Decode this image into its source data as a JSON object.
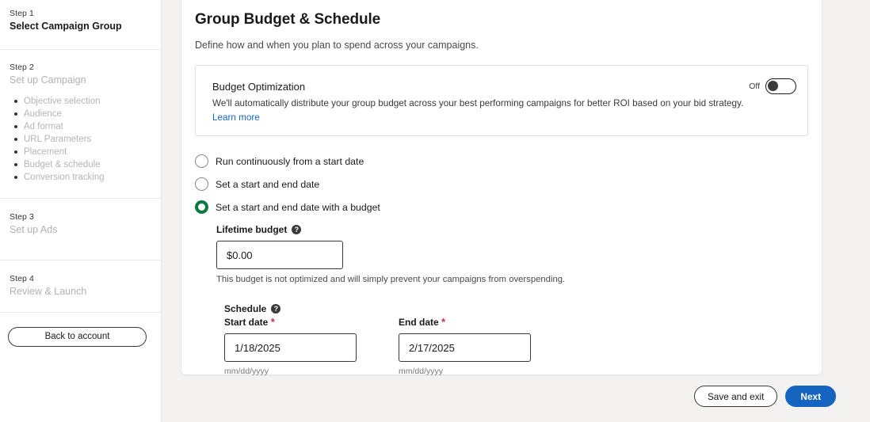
{
  "sidebar": {
    "steps": [
      {
        "kicker": "Step 1",
        "title": "Select Campaign Group",
        "state": "active"
      },
      {
        "kicker": "Step 2",
        "title": "Set up Campaign",
        "state": "inactive"
      },
      {
        "kicker": "Step 3",
        "title": "Set up Ads",
        "state": "inactive"
      },
      {
        "kicker": "Step 4",
        "title": "Review & Launch",
        "state": "inactive"
      }
    ],
    "substeps": [
      "Objective selection",
      "Audience",
      "Ad format",
      "URL Parameters",
      "Placement",
      "Budget & schedule",
      "Conversion tracking"
    ],
    "back_button": "Back to account"
  },
  "main": {
    "title": "Group Budget & Schedule",
    "subtitle": "Define how and when you plan to spend across your campaigns.",
    "optimization": {
      "title": "Budget Optimization",
      "description": "We'll automatically distribute your group budget across your best performing campaigns for better ROI based on your bid strategy.",
      "link": "Learn more",
      "toggle_label": "Off",
      "toggle_state": "off"
    },
    "schedule_options": [
      {
        "label": "Run continuously from a start date",
        "selected": false
      },
      {
        "label": "Set a start and end date",
        "selected": false
      },
      {
        "label": "Set a start and end date with a budget",
        "selected": true
      }
    ],
    "lifetime_budget": {
      "label": "Lifetime budget",
      "help_icon": "question-mark-icon",
      "value": "$0.00",
      "placeholder": "$0.00",
      "helper_text": "This budget is not optimized and will simply prevent your campaigns from overspending."
    },
    "schedule": {
      "label": "Schedule",
      "help_icon": "question-mark-icon",
      "start": {
        "label": "Start date",
        "required_marker": "*",
        "value": "1/18/2025",
        "format_hint": "mm/dd/yyyy"
      },
      "end": {
        "label": "End date",
        "required_marker": "*",
        "value": "2/17/2025",
        "format_hint": "mm/dd/yyyy"
      }
    }
  },
  "footer": {
    "save_and_exit": "Save and exit",
    "next": "Next"
  },
  "colors": {
    "accent_blue": "#1565c0",
    "selected_green": "#0a7a3f",
    "required_red": "#c4314b",
    "page_background": "#f3f2f1"
  }
}
